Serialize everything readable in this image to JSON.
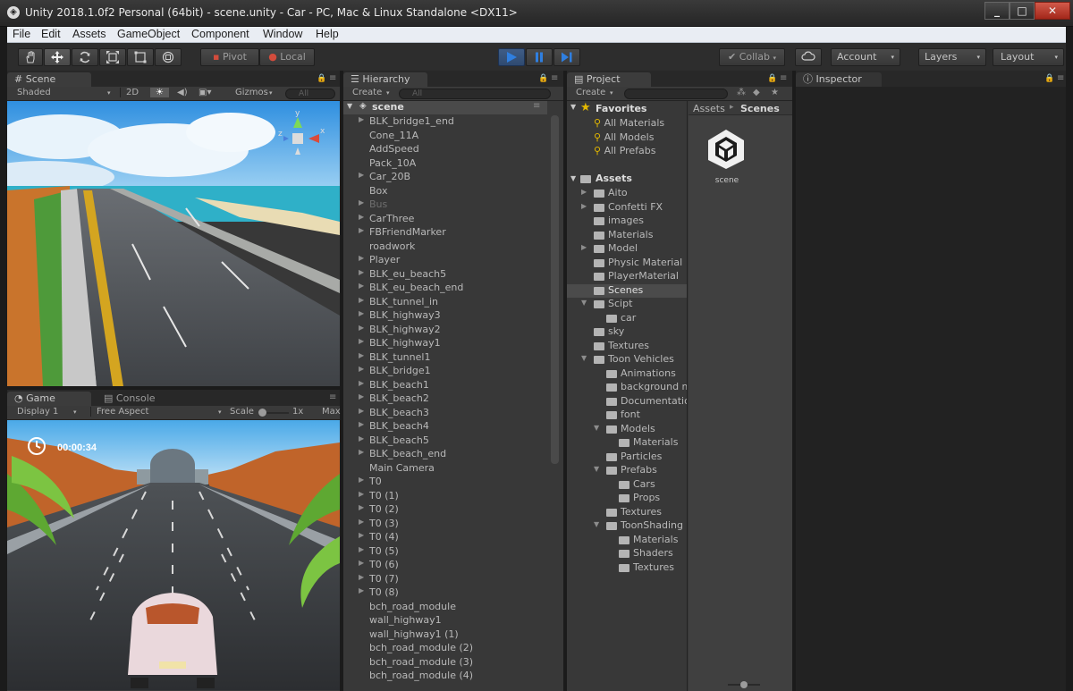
{
  "window": {
    "title": "Unity 2018.1.0f2 Personal (64bit) - scene.unity - Car - PC, Mac & Linux Standalone <DX11>",
    "controls": {
      "minimize": "_",
      "maximize": "□",
      "close": "✕"
    }
  },
  "menu": [
    "File",
    "Edit",
    "Assets",
    "GameObject",
    "Component",
    "Window",
    "Help"
  ],
  "toolbar": {
    "pivot": "Pivot",
    "local": "Local",
    "collab": "Collab",
    "account": "Account",
    "layers": "Layers",
    "layout": "Layout"
  },
  "scene_panel": {
    "tab": "Scene",
    "shading": "Shaded",
    "mode_2d": "2D",
    "gizmos": "Gizmos",
    "search_placeholder": "All",
    "gizmo_axes": {
      "y": "y",
      "x": "x",
      "z": "z"
    }
  },
  "game_panel": {
    "tab": "Game",
    "console_tab": "Console",
    "display": "Display 1",
    "aspect": "Free Aspect",
    "scale_label": "Scale",
    "scale_value": "1x",
    "maximize": "Max",
    "timer": "00:00:34"
  },
  "hierarchy": {
    "tab": "Hierarchy",
    "create": "Create",
    "search_placeholder": "All",
    "root": "scene",
    "items": [
      {
        "label": "BLK_bridge1_end",
        "arrow": true,
        "dim": false
      },
      {
        "label": "Cone_11A",
        "arrow": false,
        "dim": false
      },
      {
        "label": "AddSpeed",
        "arrow": false,
        "dim": false
      },
      {
        "label": "Pack_10A",
        "arrow": false,
        "dim": false
      },
      {
        "label": "Car_20B",
        "arrow": true,
        "dim": false
      },
      {
        "label": "Box",
        "arrow": false,
        "dim": false
      },
      {
        "label": "Bus",
        "arrow": true,
        "dim": true
      },
      {
        "label": "CarThree",
        "arrow": true,
        "dim": false
      },
      {
        "label": "FBFriendMarker",
        "arrow": true,
        "dim": false
      },
      {
        "label": "roadwork",
        "arrow": false,
        "dim": false
      },
      {
        "label": "Player",
        "arrow": true,
        "dim": false
      },
      {
        "label": "BLK_eu_beach5",
        "arrow": true,
        "dim": false
      },
      {
        "label": "BLK_eu_beach_end",
        "arrow": true,
        "dim": false
      },
      {
        "label": "BLK_tunnel_in",
        "arrow": true,
        "dim": false
      },
      {
        "label": "BLK_highway3",
        "arrow": true,
        "dim": false
      },
      {
        "label": "BLK_highway2",
        "arrow": true,
        "dim": false
      },
      {
        "label": "BLK_highway1",
        "arrow": true,
        "dim": false
      },
      {
        "label": "BLK_tunnel1",
        "arrow": true,
        "dim": false
      },
      {
        "label": "BLK_bridge1",
        "arrow": true,
        "dim": false
      },
      {
        "label": "BLK_beach1",
        "arrow": true,
        "dim": false
      },
      {
        "label": "BLK_beach2",
        "arrow": true,
        "dim": false
      },
      {
        "label": "BLK_beach3",
        "arrow": true,
        "dim": false
      },
      {
        "label": "BLK_beach4",
        "arrow": true,
        "dim": false
      },
      {
        "label": "BLK_beach5",
        "arrow": true,
        "dim": false
      },
      {
        "label": "BLK_beach_end",
        "arrow": true,
        "dim": false
      },
      {
        "label": "Main Camera",
        "arrow": false,
        "dim": false
      },
      {
        "label": "T0",
        "arrow": true,
        "dim": false
      },
      {
        "label": "T0 (1)",
        "arrow": true,
        "dim": false
      },
      {
        "label": "T0 (2)",
        "arrow": true,
        "dim": false
      },
      {
        "label": "T0 (3)",
        "arrow": true,
        "dim": false
      },
      {
        "label": "T0 (4)",
        "arrow": true,
        "dim": false
      },
      {
        "label": "T0 (5)",
        "arrow": true,
        "dim": false
      },
      {
        "label": "T0 (6)",
        "arrow": true,
        "dim": false
      },
      {
        "label": "T0 (7)",
        "arrow": true,
        "dim": false
      },
      {
        "label": "T0 (8)",
        "arrow": true,
        "dim": false
      },
      {
        "label": "bch_road_module",
        "arrow": false,
        "dim": false
      },
      {
        "label": "wall_highway1",
        "arrow": false,
        "dim": false
      },
      {
        "label": "wall_highway1 (1)",
        "arrow": false,
        "dim": false
      },
      {
        "label": "bch_road_module (2)",
        "arrow": false,
        "dim": false
      },
      {
        "label": "bch_road_module (3)",
        "arrow": false,
        "dim": false
      },
      {
        "label": "bch_road_module (4)",
        "arrow": false,
        "dim": false
      }
    ]
  },
  "project": {
    "tab": "Project",
    "create": "Create",
    "favorites": "Favorites",
    "favorite_items": [
      "All Materials",
      "All Models",
      "All Prefabs"
    ],
    "assets_root": "Assets",
    "tree": [
      {
        "label": "Aito",
        "depth": 1,
        "arrow": "right",
        "sel": false
      },
      {
        "label": "Confetti FX",
        "depth": 1,
        "arrow": "right",
        "sel": false
      },
      {
        "label": "images",
        "depth": 1,
        "arrow": "none",
        "sel": false
      },
      {
        "label": "Materials",
        "depth": 1,
        "arrow": "none",
        "sel": false
      },
      {
        "label": "Model",
        "depth": 1,
        "arrow": "right",
        "sel": false
      },
      {
        "label": "Physic Material",
        "depth": 1,
        "arrow": "none",
        "sel": false
      },
      {
        "label": "PlayerMaterial",
        "depth": 1,
        "arrow": "none",
        "sel": false
      },
      {
        "label": "Scenes",
        "depth": 1,
        "arrow": "none",
        "sel": true
      },
      {
        "label": "Scipt",
        "depth": 1,
        "arrow": "down",
        "sel": false
      },
      {
        "label": "car",
        "depth": 2,
        "arrow": "none",
        "sel": false
      },
      {
        "label": "sky",
        "depth": 1,
        "arrow": "none",
        "sel": false
      },
      {
        "label": "Textures",
        "depth": 1,
        "arrow": "none",
        "sel": false
      },
      {
        "label": "Toon Vehicles",
        "depth": 1,
        "arrow": "down",
        "sel": false
      },
      {
        "label": "Animations",
        "depth": 2,
        "arrow": "none",
        "sel": false
      },
      {
        "label": "background m",
        "depth": 2,
        "arrow": "none",
        "sel": false
      },
      {
        "label": "Documentatio",
        "depth": 2,
        "arrow": "none",
        "sel": false
      },
      {
        "label": "font",
        "depth": 2,
        "arrow": "none",
        "sel": false
      },
      {
        "label": "Models",
        "depth": 2,
        "arrow": "down",
        "sel": false
      },
      {
        "label": "Materials",
        "depth": 3,
        "arrow": "none",
        "sel": false
      },
      {
        "label": "Particles",
        "depth": 2,
        "arrow": "none",
        "sel": false
      },
      {
        "label": "Prefabs",
        "depth": 2,
        "arrow": "down",
        "sel": false
      },
      {
        "label": "Cars",
        "depth": 3,
        "arrow": "none",
        "sel": false
      },
      {
        "label": "Props",
        "depth": 3,
        "arrow": "none",
        "sel": false
      },
      {
        "label": "Textures",
        "depth": 2,
        "arrow": "none",
        "sel": false
      },
      {
        "label": "ToonShading",
        "depth": 2,
        "arrow": "down",
        "sel": false
      },
      {
        "label": "Materials",
        "depth": 3,
        "arrow": "none",
        "sel": false
      },
      {
        "label": "Shaders",
        "depth": 3,
        "arrow": "none",
        "sel": false
      },
      {
        "label": "Textures",
        "depth": 3,
        "arrow": "none",
        "sel": false
      }
    ],
    "breadcrumb": {
      "root": "Assets",
      "separator": "▸",
      "current": "Scenes"
    },
    "asset_item": "scene"
  },
  "inspector": {
    "tab": "Inspector"
  },
  "colors": {
    "play_blue": "#2f7fe0",
    "selection": "#4b4b4b",
    "favorite_star": "#e3b800"
  }
}
